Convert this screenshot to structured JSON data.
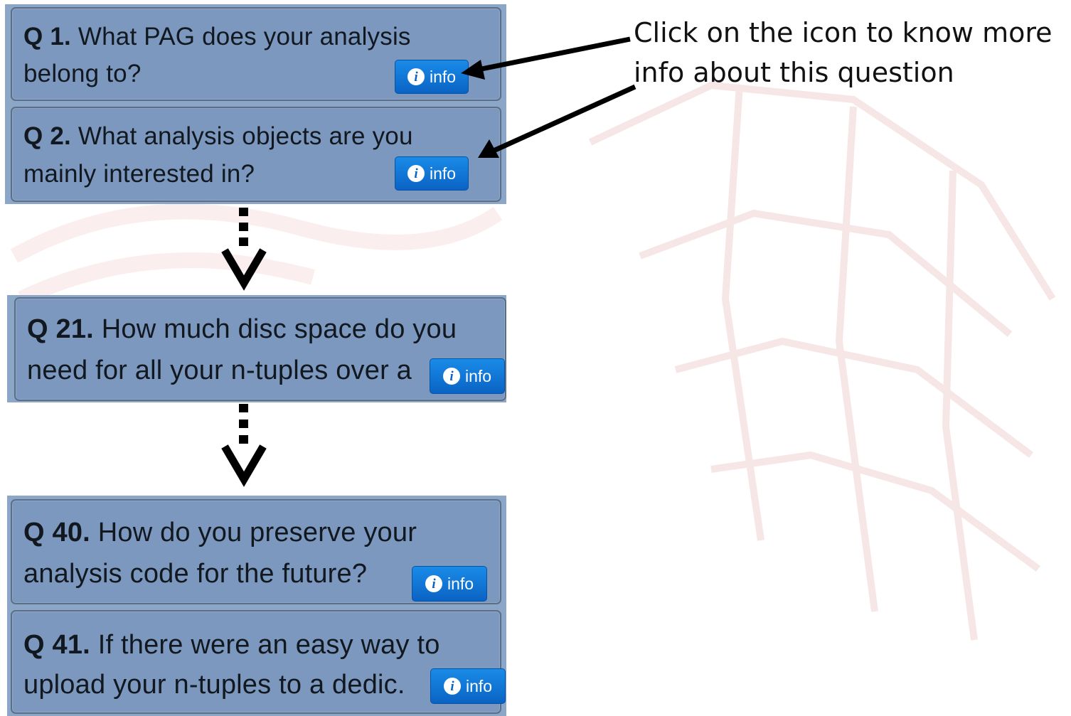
{
  "callout": {
    "line1": "Click on the icon to know more",
    "line2": "info about this question"
  },
  "info_label": "info",
  "info_icon": "info-circle-icon",
  "colors": {
    "card": "#7d98bf",
    "card_border": "#5c6f89",
    "button": "#0a63c4",
    "arrow": "#000000"
  },
  "questions": [
    {
      "num": "Q 1.",
      "line1": "What PAG does your analysis",
      "line2": "belong to?"
    },
    {
      "num": "Q 2.",
      "line1": "What analysis objects are you",
      "line2": "mainly interested in?"
    },
    {
      "num": "Q 21.",
      "line1": "How much disc space do you",
      "line2": "need for all your n-tuples over a"
    },
    {
      "num": "Q 40.",
      "line1": "How do you preserve your",
      "line2": "analysis code for the future?"
    },
    {
      "num": "Q 41.",
      "line1": "If there were an easy way to",
      "line2": "upload your n-tuples to a dedic."
    }
  ]
}
